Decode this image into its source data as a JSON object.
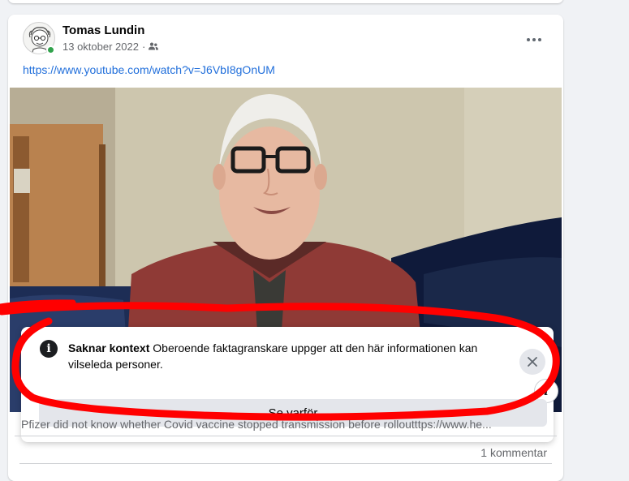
{
  "post": {
    "author": "Tomas Lundin",
    "date": "13 oktober 2022",
    "separator": "·",
    "audience_icon": "friends-icon",
    "more_icon": "more-options-icon",
    "link": "https://www.youtube.com/watch?v=J6VbI8gOnUM",
    "caption": "Pfizer did not know whether Covid vaccine stopped transmission before rolloutttps://www.he...",
    "comments": "1 kommentar"
  },
  "warning": {
    "title": "Saknar kontext",
    "text": "Oberoende faktagranskare uppger att den här informationen kan vilseleda personer.",
    "button": "Se varför",
    "info_icon_glyph": "i",
    "small_info_glyph": "i"
  },
  "colors": {
    "link": "#216fdb",
    "online": "#31a24c",
    "annotation": "#ff0000"
  }
}
